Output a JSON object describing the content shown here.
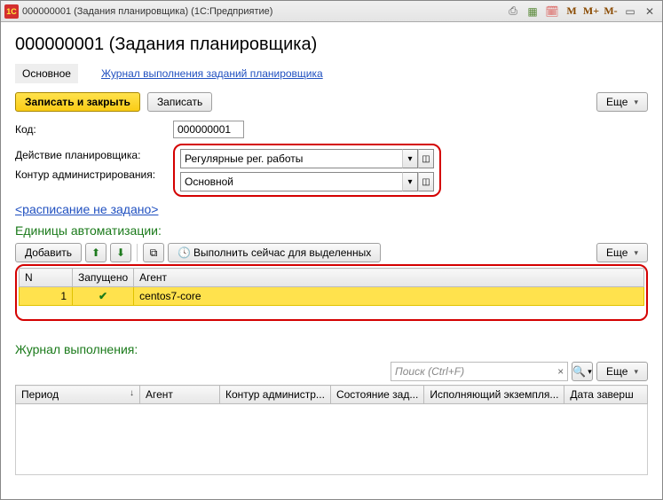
{
  "titlebar": {
    "logo_text": "1C",
    "title": "000000001 (Задания планировщика)  (1С:Предприятие)",
    "btn_m": "M",
    "btn_mplus": "M+",
    "btn_mminus": "M-"
  },
  "header_title": "000000001 (Задания планировщика)",
  "tabs": {
    "main": "Основное",
    "journal": "Журнал выполнения заданий планировщика"
  },
  "toolbar": {
    "save_close": "Записать и закрыть",
    "save": "Записать",
    "more": "Еще"
  },
  "fields": {
    "code_label": "Код:",
    "code_value": "000000001",
    "action_label": "Действие планировщика:",
    "action_value": "Регулярные рег. работы",
    "circuit_label": "Контур администрирования:",
    "circuit_value": "Основной"
  },
  "schedule_link": "<расписание не задано>",
  "units": {
    "title": "Единицы автоматизации:",
    "add": "Добавить",
    "run_now": "Выполнить сейчас для выделенных",
    "more": "Еще",
    "cols": {
      "n": "N",
      "started": "Запущено",
      "agent": "Агент"
    },
    "rows": [
      {
        "n": "1",
        "started": true,
        "agent": "centos7-core"
      }
    ]
  },
  "journal": {
    "title": "Журнал выполнения:",
    "search_placeholder": "Поиск (Ctrl+F)",
    "more": "Еще",
    "cols": {
      "period": "Период",
      "agent": "Агент",
      "circuit": "Контур администр...",
      "state": "Состояние зад...",
      "executor": "Исполняющий экземпля...",
      "date_done": "Дата заверш"
    }
  }
}
